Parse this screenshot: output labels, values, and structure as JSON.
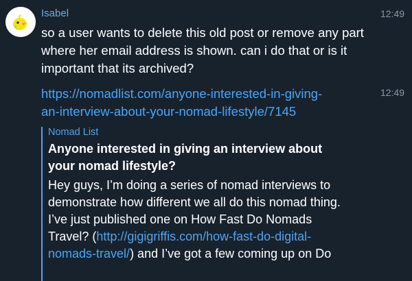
{
  "message": {
    "sender": "Isabel",
    "text": "so a user wants to delete this old post or remove any part where her email address is shown. can i do that or is it important that its archived?",
    "time": "12:49"
  },
  "link_message": {
    "url_line1": "https://nomadlist.com/anyone-interested-in-giving-",
    "url_line2": "an-interview-about-your-nomad-lifestyle/7145",
    "time": "12:49"
  },
  "preview": {
    "site": "Nomad List",
    "title": "Anyone interested in giving an interview about your nomad lifestyle?",
    "body_before": "Hey guys, I’m doing a series of nomad interviews to demonstrate how different we all do this nomad thing. I’ve just published one on How Fast Do Nomads Travel? (",
    "body_link": "http://gigigriffis.com/how-fast-do-digital-nomads-travel/",
    "body_after": ") and I’ve got a few coming up on Do"
  },
  "colors": {
    "background": "#18222d",
    "accent": "#4ea4f4",
    "sender": "#62b0f0",
    "timestamp": "#8a97a6"
  }
}
